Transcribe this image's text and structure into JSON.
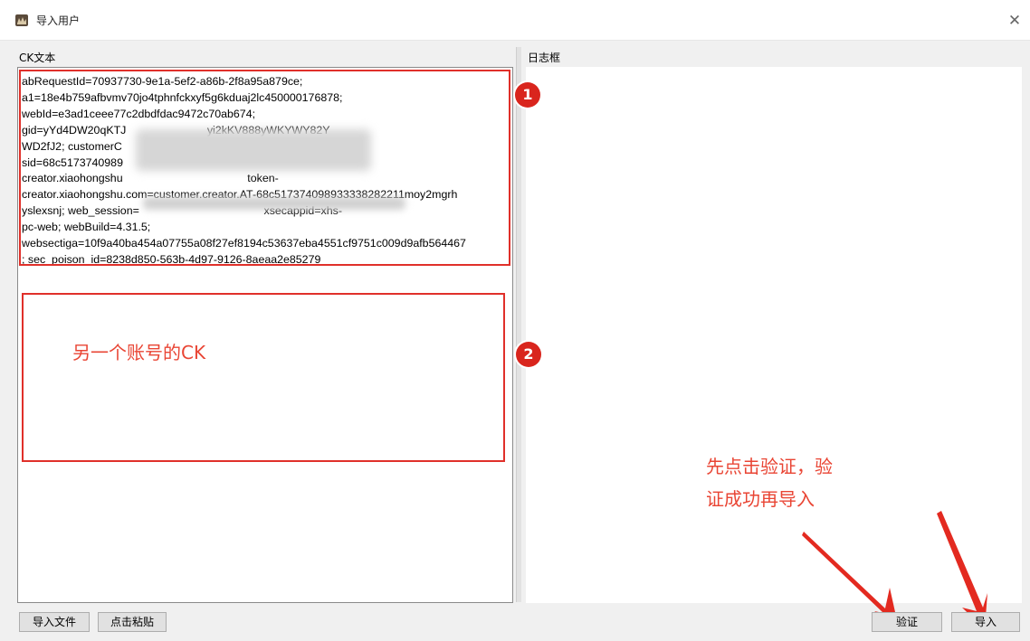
{
  "window": {
    "title": "导入用户",
    "close_glyph": "✕",
    "app_icon": "app-logo-icon"
  },
  "labels": {
    "ck_text": "CK文本",
    "log_box": "日志框"
  },
  "ck_content": "abRequestId=70937730-9e1a-5ef2-a86b-2f8a95a879ce;\na1=18e4b759afbvmv70jo4tphnfckxyf5g6kduaj2lc450000176878;\nwebId=e3ad1ceee77c2dbdfdac9472c70ab674;\ngid=yYd4DW20qKTJ                          yi2kKV888yWKYWY82Y\nWD2fJ2; customerC\nsid=68c5173740989\ncreator.xiaohongshu                                        token-\ncreator.xiaohongshu.com=customer.creator.AT-68c517374098933338282211moy2mgrh\nyslexsnj; web_session=                                        xsecappid=xhs-\npc-web; webBuild=4.31.5;\nwebsectiga=10f9a40ba454a07755a08f27ef8194c53637eba4551cf9751c009d9afb564467\n; sec_poison_id=8238d850-563b-4d97-9126-8aeaa2e85279",
  "annotations": {
    "badge1": "1",
    "badge2": "2",
    "other_account_note": "另一个账号的CK",
    "instruction": "先点击验证，验\n证成功再导入"
  },
  "buttons": {
    "import_file": "导入文件",
    "paste": "点击粘贴",
    "verify": "验证",
    "import": "导入"
  },
  "colors": {
    "annotation_red": "#e0302a",
    "badge_red": "#d9251d",
    "note_text_red": "#e94534"
  }
}
